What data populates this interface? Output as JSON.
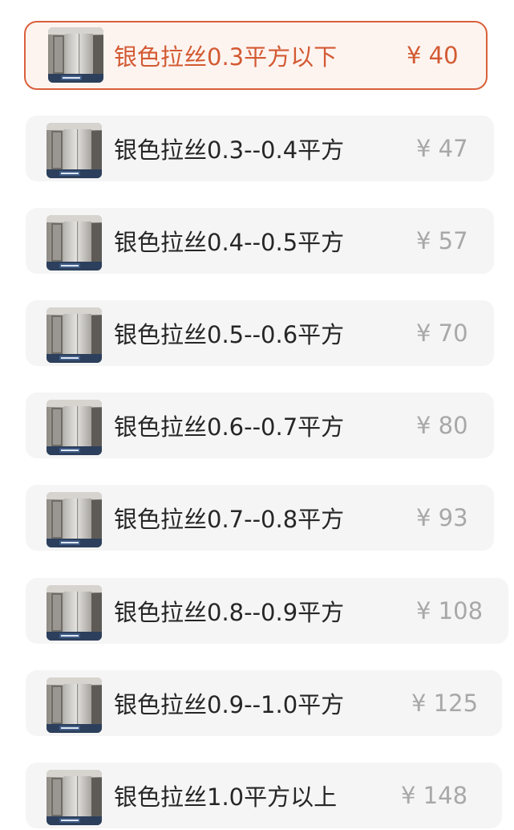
{
  "colors": {
    "accent": "#d9603a",
    "option_bg": "#f5f5f5",
    "text": "#262626",
    "price": "#a8a8a8"
  },
  "options": [
    {
      "label": "银色拉丝0.3平方以下",
      "price": "¥ 40",
      "selected": true
    },
    {
      "label": "银色拉丝0.3--0.4平方",
      "price": "¥ 47",
      "selected": false
    },
    {
      "label": "银色拉丝0.4--0.5平方",
      "price": "¥ 57",
      "selected": false
    },
    {
      "label": "银色拉丝0.5--0.6平方",
      "price": "¥ 70",
      "selected": false
    },
    {
      "label": "银色拉丝0.6--0.7平方",
      "price": "¥ 80",
      "selected": false
    },
    {
      "label": "银色拉丝0.7--0.8平方",
      "price": "¥ 93",
      "selected": false
    },
    {
      "label": "银色拉丝0.8--0.9平方",
      "price": "¥ 108",
      "selected": false
    },
    {
      "label": "银色拉丝0.9--1.0平方",
      "price": "¥ 125",
      "selected": false
    },
    {
      "label": "银色拉丝1.0平方以上",
      "price": "¥ 148",
      "selected": false
    }
  ]
}
